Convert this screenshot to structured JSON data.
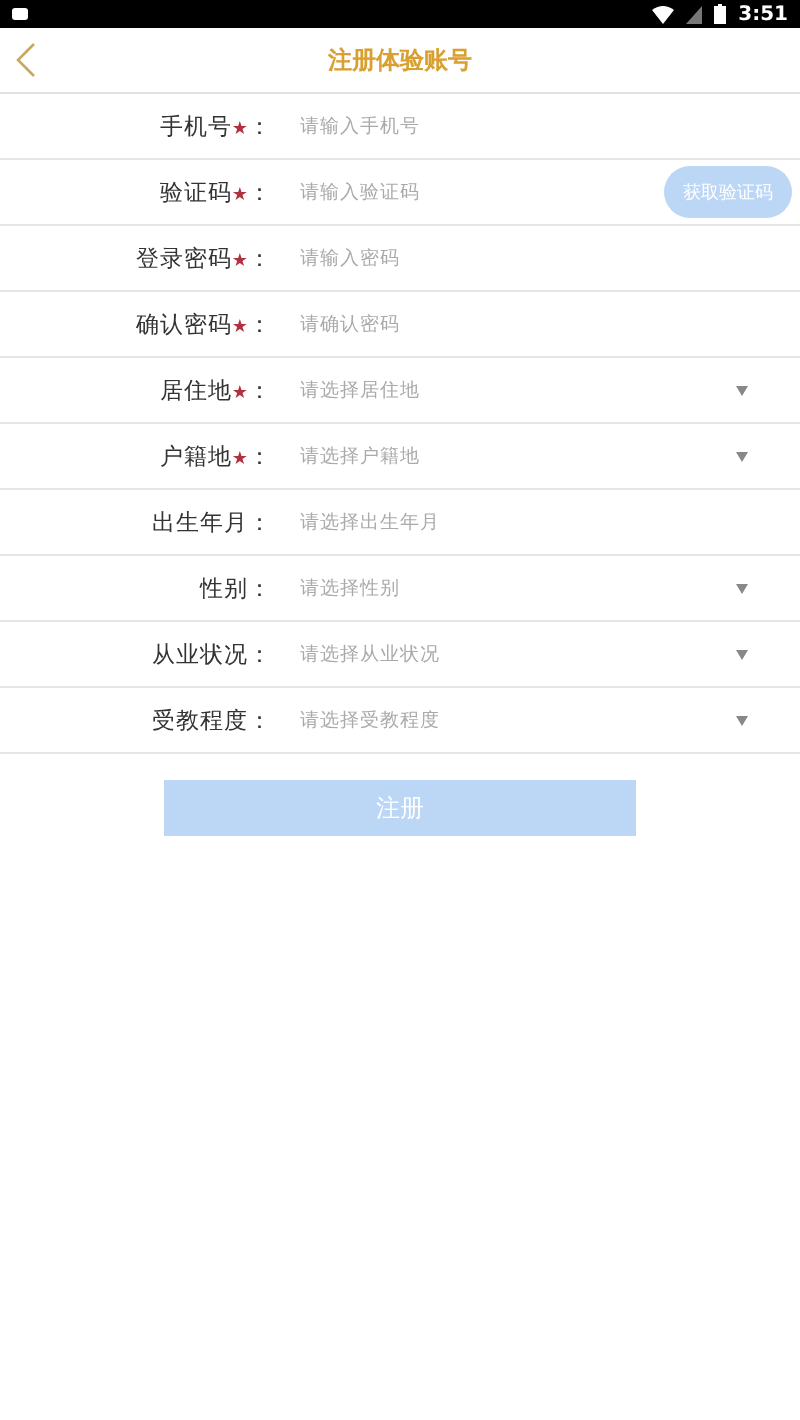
{
  "status_bar": {
    "time": "3:51"
  },
  "header": {
    "title": "注册体验账号"
  },
  "required_mark": "★",
  "label_suffix": "：",
  "fields": [
    {
      "label": "手机号",
      "required": true,
      "kind": "input",
      "placeholder": "请输入手机号"
    },
    {
      "label": "验证码",
      "required": true,
      "kind": "code",
      "placeholder": "请输入验证码",
      "button": {
        "label": "获取验证码",
        "disabled": true
      }
    },
    {
      "label": "登录密码",
      "required": true,
      "kind": "input",
      "placeholder": "请输入密码"
    },
    {
      "label": "确认密码",
      "required": true,
      "kind": "input",
      "placeholder": "请确认密码"
    },
    {
      "label": "居住地",
      "required": true,
      "kind": "select",
      "placeholder": "请选择居住地"
    },
    {
      "label": "户籍地",
      "required": true,
      "kind": "select",
      "placeholder": "请选择户籍地"
    },
    {
      "label": "出生年月",
      "required": false,
      "kind": "date",
      "placeholder": "请选择出生年月"
    },
    {
      "label": "性别",
      "required": false,
      "kind": "select",
      "placeholder": "请选择性别"
    },
    {
      "label": "从业状况",
      "required": false,
      "kind": "select",
      "placeholder": "请选择从业状况"
    },
    {
      "label": "受教程度",
      "required": false,
      "kind": "select",
      "placeholder": "请选择受教程度"
    }
  ],
  "submit": {
    "label": "注册",
    "disabled": true
  }
}
